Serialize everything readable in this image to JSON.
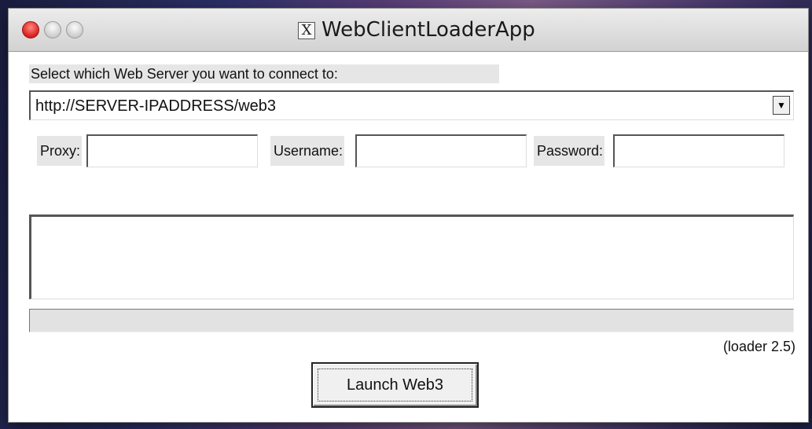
{
  "window": {
    "title": "WebClientLoaderApp",
    "app_icon": "x11-icon"
  },
  "server": {
    "prompt": "Select which Web Server you want to connect to:",
    "selected": "http://SERVER-IPADDRESS/web3",
    "dropdown_arrow": "▼"
  },
  "fields": {
    "proxy_label": "Proxy:",
    "proxy_value": "",
    "username_label": "Username:",
    "username_value": "",
    "password_label": "Password:",
    "password_value": ""
  },
  "log": {
    "text": ""
  },
  "progress": {
    "fraction": 0
  },
  "version": "(loader 2.5)",
  "launch_button": "Launch Web3",
  "colors": {
    "close": "#d81e1e",
    "panel": "#e6e6e6"
  }
}
